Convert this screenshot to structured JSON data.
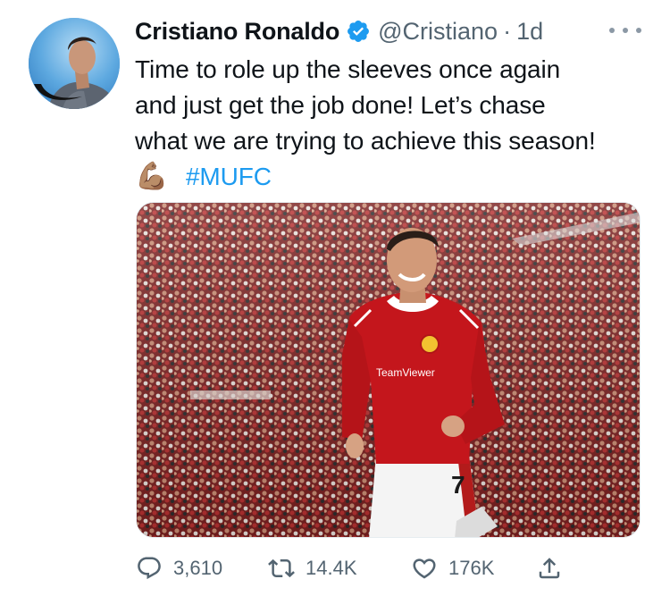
{
  "author": {
    "display_name": "Cristiano Ronaldo",
    "handle": "@Cristiano",
    "separator": "·",
    "timestamp": "1d",
    "verified": true
  },
  "tweet": {
    "lines": [
      "Time to role up the sleeves once again",
      "and just get the job done! Let’s chase",
      "what we are trying to achieve this season!"
    ],
    "emoji": "💪🏽",
    "hashtag": "#MUFC"
  },
  "actions": {
    "replies": "3,610",
    "retweets": "14.4K",
    "likes": "176K"
  },
  "colors": {
    "accent": "#1d9bf0",
    "muted": "#536471"
  }
}
